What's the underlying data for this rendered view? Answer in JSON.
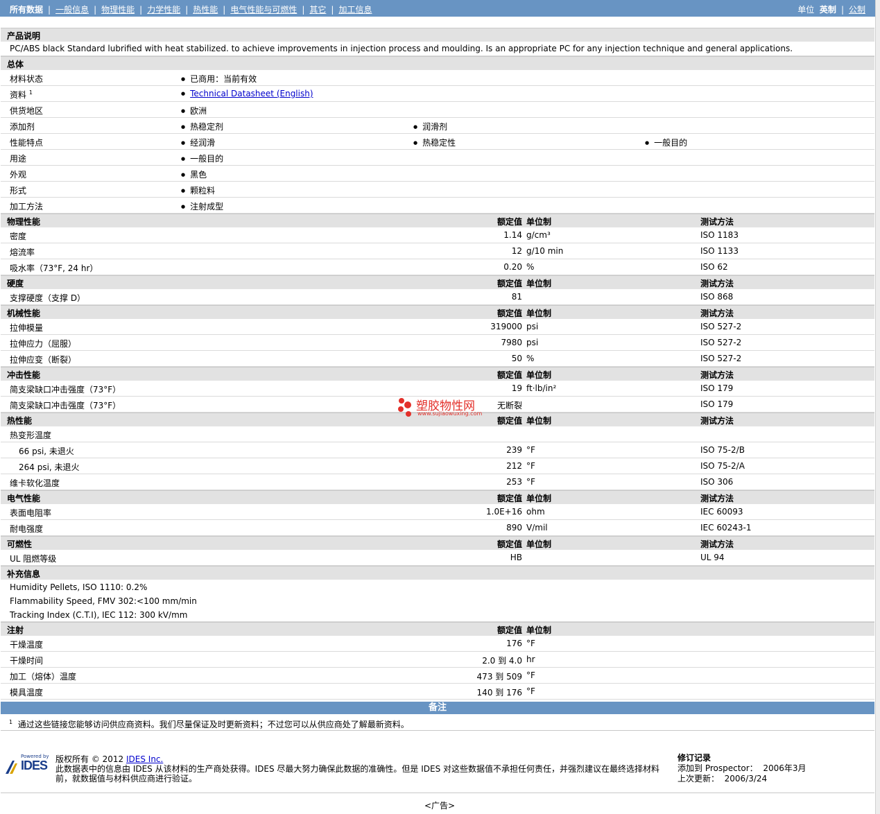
{
  "nav": {
    "items": [
      "所有数据",
      "一般信息",
      "物理性能",
      "力学性能",
      "热性能",
      "电气性能与可燃性",
      "其它",
      "加工信息"
    ],
    "units_label": "单位",
    "unit_imperial": "英制",
    "unit_metric": "公制"
  },
  "product": {
    "title": "产品说明",
    "description": "PC/ABS black Standard lubrified with heat stabilized. to achieve improvements in injection process and moulding. Is an appropriate PC for any injection technique and general applications."
  },
  "general": {
    "title": "总体",
    "rows": [
      {
        "label": "材料状态",
        "values": [
          "已商用：当前有效"
        ]
      },
      {
        "label": "资料",
        "sup": "1",
        "values": [
          "Technical Datasheet (English)"
        ],
        "link": true
      },
      {
        "label": "供货地区",
        "values": [
          "欧洲"
        ]
      },
      {
        "label": "添加剂",
        "values": [
          "热稳定剂",
          "润滑剂"
        ]
      },
      {
        "label": "性能特点",
        "values": [
          "经润滑",
          "热稳定性",
          "一般目的"
        ]
      },
      {
        "label": "用途",
        "values": [
          "一般目的"
        ]
      },
      {
        "label": "外观",
        "values": [
          "黑色"
        ]
      },
      {
        "label": "形式",
        "values": [
          "颗粒料"
        ]
      },
      {
        "label": "加工方法",
        "values": [
          "注射成型"
        ]
      }
    ]
  },
  "col_headers": {
    "nominal": "额定值",
    "unit": "单位制",
    "test": "测试方法"
  },
  "sections": [
    {
      "title": "物理性能",
      "rows": [
        {
          "label": "密度",
          "value": "1.14",
          "unit": "g/cm³",
          "test": "ISO 1183"
        },
        {
          "label": "熔流率",
          "value": "12",
          "unit": "g/10 min",
          "test": "ISO 1133"
        },
        {
          "label": "吸水率（73°F, 24 hr）",
          "value": "0.20",
          "unit": "%",
          "test": "ISO 62"
        }
      ]
    },
    {
      "title": "硬度",
      "rows": [
        {
          "label": "支撑硬度（支撑 D）",
          "value": "81",
          "unit": "",
          "test": "ISO 868"
        }
      ]
    },
    {
      "title": "机械性能",
      "rows": [
        {
          "label": "拉伸模量",
          "value": "319000",
          "unit": "psi",
          "test": "ISO 527-2"
        },
        {
          "label": "拉伸应力（屈服）",
          "value": "7980",
          "unit": "psi",
          "test": "ISO 527-2"
        },
        {
          "label": "拉伸应变（断裂）",
          "value": "50",
          "unit": "%",
          "test": "ISO 527-2"
        }
      ]
    },
    {
      "title": "冲击性能",
      "rows": [
        {
          "label": "简支梁缺口冲击强度（73°F）",
          "value": "19",
          "unit": "ft·lb/in²",
          "test": "ISO 179"
        },
        {
          "label": "简支梁缺口冲击强度（73°F）",
          "value": "无断裂",
          "unit": "",
          "test": "ISO 179"
        }
      ]
    },
    {
      "title": "热性能",
      "rows": [
        {
          "label": "热变形温度",
          "value": "",
          "unit": "",
          "test": ""
        },
        {
          "label": "66 psi, 未退火",
          "indent": true,
          "value": "239",
          "unit": "°F",
          "test": "ISO 75-2/B"
        },
        {
          "label": "264 psi, 未退火",
          "indent": true,
          "value": "212",
          "unit": "°F",
          "test": "ISO 75-2/A"
        },
        {
          "label": "维卡软化温度",
          "value": "253",
          "unit": "°F",
          "test": "ISO 306"
        }
      ]
    },
    {
      "title": "电气性能",
      "rows": [
        {
          "label": "表面电阻率",
          "value": "1.0E+16",
          "unit": "ohm",
          "test": "IEC 60093"
        },
        {
          "label": "耐电强度",
          "value": "890",
          "unit": "V/mil",
          "test": "IEC 60243-1"
        }
      ]
    },
    {
      "title": "可燃性",
      "rows": [
        {
          "label": "UL 阻燃等级",
          "value": "HB",
          "unit": "",
          "test": "UL 94"
        }
      ]
    }
  ],
  "supplemental": {
    "title": "补充信息",
    "lines": [
      "Humidity Pellets, ISO 1110: 0.2%",
      "Flammability Speed, FMV 302:<100 mm/min",
      "Tracking Index (C.T.I), IEC 112: 300 kV/mm"
    ]
  },
  "injection": {
    "title": "注射",
    "rows": [
      {
        "label": "干燥温度",
        "value": "176",
        "unit": "°F"
      },
      {
        "label": "干燥时间",
        "value": "2.0 到   4.0",
        "unit": "hr"
      },
      {
        "label": "加工（熔体）温度",
        "value": "473 到   509",
        "unit": "°F"
      },
      {
        "label": "模具温度",
        "value": "140 到   176",
        "unit": "°F"
      }
    ]
  },
  "remarks": {
    "title": "备注",
    "footnote_num": "1",
    "footnote": "通过这些链接您能够访问供应商资料。我们尽量保证及时更新资料；不过您可以从供应商处了解最新资料。"
  },
  "footer": {
    "powered_by": "Powered by",
    "logo_text": "IDES",
    "copyright_prefix": "版权所有 © 2012 ",
    "company_link": "IDES Inc.",
    "disclaimer": "此数据表中的信息由 IDES 从该材料的生产商处获得。IDES 尽最大努力确保此数据的准确性。但是 IDES 对这些数据值不承担任何责任，并强烈建议在最终选择材料前，就数据值与材料供应商进行验证。",
    "revision_title": "修订记录",
    "added_label": "添加到 Prospector：",
    "added_value": "2006年3月",
    "updated_label": "上次更新：",
    "updated_value": "2006/3/24",
    "ad": "<广告>"
  },
  "watermark": {
    "name": "塑胶物性网",
    "url": "www.sujiaowuxing.com"
  },
  "colors": {
    "nav_bg": "#6894c3",
    "header_bg": "#e2e2e2",
    "link": "#0000cc",
    "watermark": "#e3302a"
  }
}
